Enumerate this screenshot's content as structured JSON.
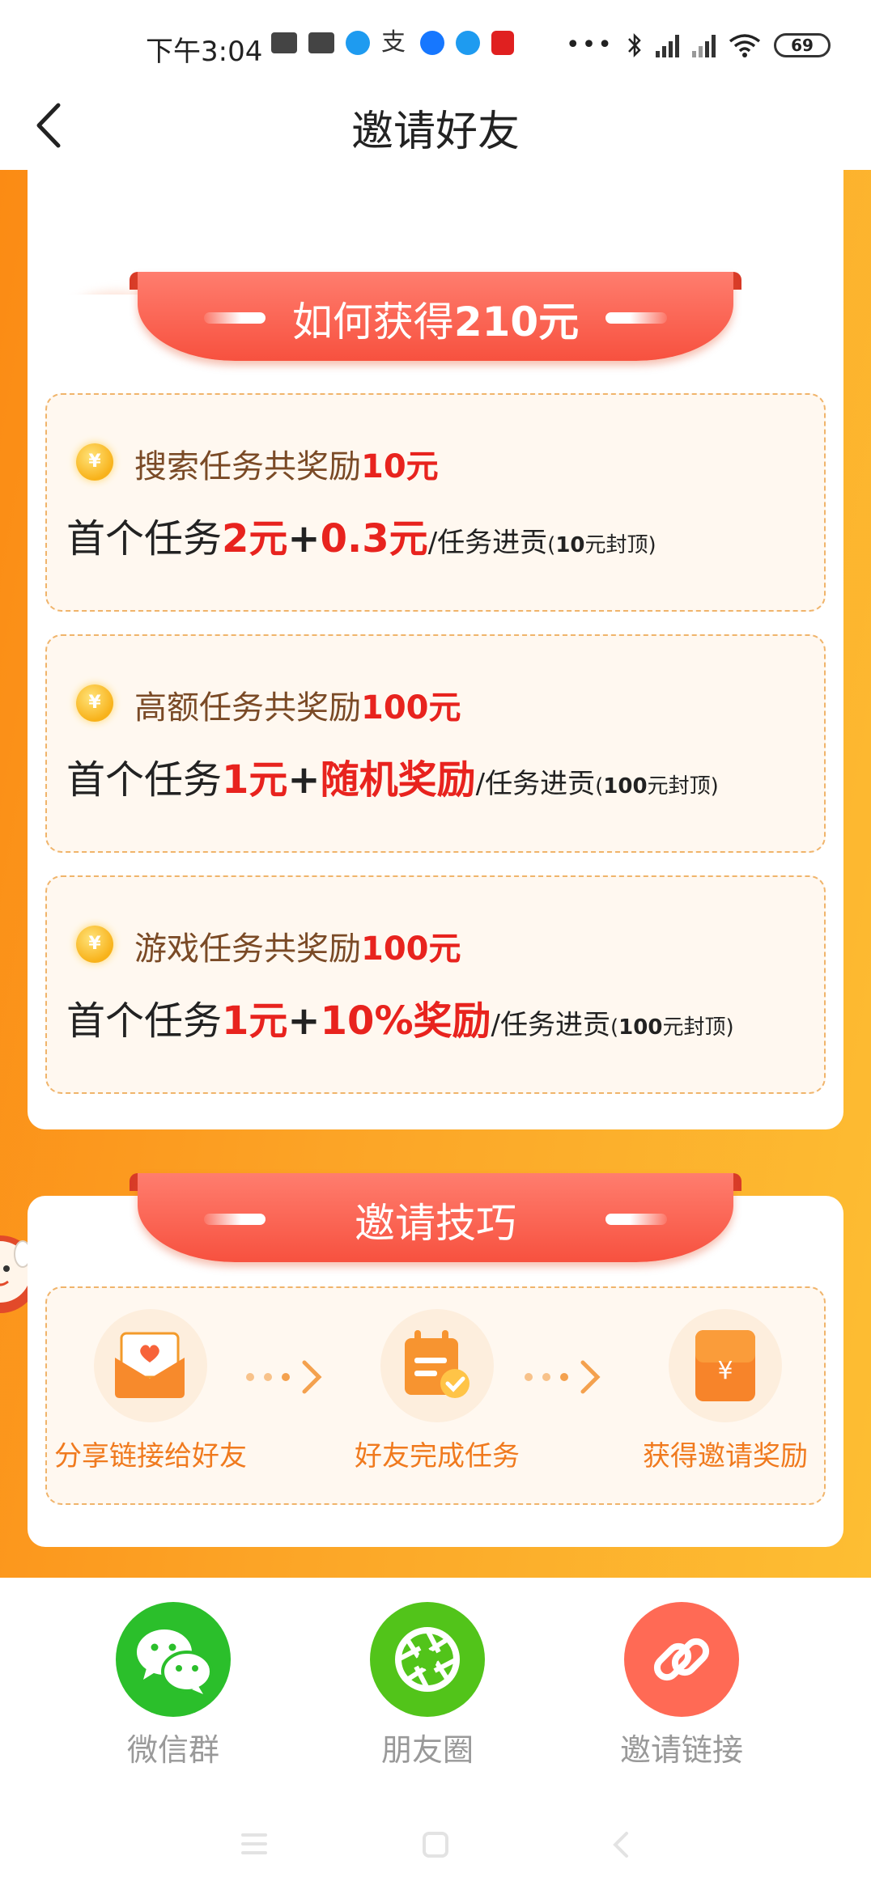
{
  "status_bar": {
    "time": "下午3:04",
    "battery": "69"
  },
  "header": {
    "title": "邀请好友"
  },
  "how_to_earn": {
    "title_prefix": "如何获得",
    "title_amount": "210元",
    "tasks": [
      {
        "heading_prefix": "搜索任务共奖励",
        "heading_amount": "10元",
        "first_prefix": "首个任务",
        "first_amount": "2元",
        "plus": "+",
        "bonus": "0.3元",
        "suffix": "/任务进贡",
        "cap_open": "(",
        "cap_amount": "10",
        "cap_label": "元封顶)"
      },
      {
        "heading_prefix": "高额任务共奖励",
        "heading_amount": "100元",
        "first_prefix": "首个任务",
        "first_amount": "1元",
        "plus": "+",
        "bonus": "随机奖励",
        "suffix": "/任务进贡",
        "cap_open": "(",
        "cap_amount": "100",
        "cap_label": "元封顶)"
      },
      {
        "heading_prefix": "游戏任务共奖励",
        "heading_amount": "100元",
        "first_prefix": "首个任务",
        "first_amount": "1元",
        "plus": "+",
        "bonus": "10%奖励",
        "suffix": "/任务进贡",
        "cap_open": "(",
        "cap_amount": "100",
        "cap_label": "元封顶)"
      }
    ]
  },
  "tips": {
    "title": "邀请技巧",
    "steps": [
      {
        "label": "分享链接给好友",
        "icon": "envelope-heart-icon"
      },
      {
        "label": "好友完成任务",
        "icon": "calendar-check-icon"
      },
      {
        "label": "获得邀请奖励",
        "icon": "yuan-reward-icon"
      }
    ]
  },
  "share": {
    "options": [
      {
        "label": "微信群",
        "icon": "wechat-icon",
        "color": "#2bbf2b"
      },
      {
        "label": "朋友圈",
        "icon": "moments-icon",
        "color": "#52c41a"
      },
      {
        "label": "邀请链接",
        "icon": "link-icon",
        "color": "#ff6a55"
      }
    ]
  },
  "colors": {
    "accent_red": "#e8231e",
    "orange_bg": "#fca426",
    "ribbon": "#f7513f"
  }
}
